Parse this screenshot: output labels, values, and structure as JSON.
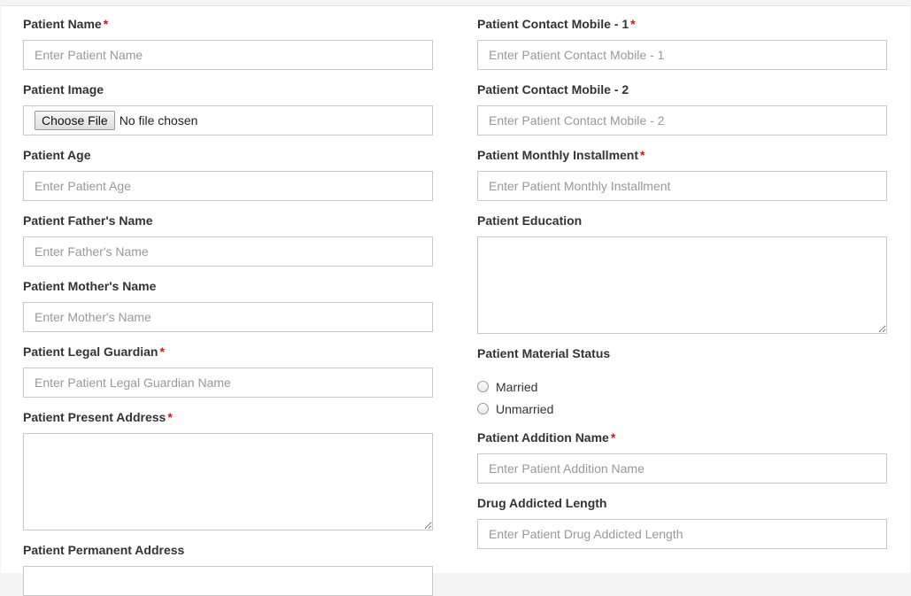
{
  "left_column": [
    {
      "id": "patient-name",
      "label": "Patient Name",
      "required": "*",
      "type": "text",
      "placeholder": "Enter Patient Name"
    },
    {
      "id": "patient-image",
      "label": "Patient Image",
      "required": "",
      "type": "file",
      "button": "Choose File",
      "status": "No file chosen"
    },
    {
      "id": "patient-age",
      "label": "Patient Age",
      "required": "",
      "type": "text",
      "placeholder": "Enter Patient Age"
    },
    {
      "id": "father-name",
      "label": "Patient Father's Name",
      "required": "",
      "type": "text",
      "placeholder": "Enter Father's Name"
    },
    {
      "id": "mother-name",
      "label": "Patient Mother's Name",
      "required": "",
      "type": "text",
      "placeholder": "Enter Mother's Name"
    },
    {
      "id": "legal-guardian",
      "label": "Patient Legal Guardian",
      "required": "*",
      "type": "text",
      "placeholder": "Enter Patient Legal Guardian Name"
    },
    {
      "id": "present-address",
      "label": "Patient Present Address",
      "required": "*",
      "type": "textarea",
      "placeholder": ""
    },
    {
      "id": "permanent-address",
      "label": "Patient Permanent Address",
      "required": "",
      "type": "text",
      "placeholder": ""
    }
  ],
  "right_column": [
    {
      "id": "contact-mobile-1",
      "label": "Patient Contact Mobile - 1",
      "required": "*",
      "type": "text",
      "placeholder": "Enter Patient Contact Mobile - 1"
    },
    {
      "id": "contact-mobile-2",
      "label": "Patient Contact Mobile - 2",
      "required": "",
      "type": "text",
      "placeholder": "Enter Patient Contact Mobile - 2"
    },
    {
      "id": "monthly-installment",
      "label": "Patient Monthly Installment",
      "required": "*",
      "type": "text",
      "placeholder": "Enter Patient Monthly Installment"
    },
    {
      "id": "education",
      "label": "Patient Education",
      "required": "",
      "type": "textarea",
      "placeholder": ""
    },
    {
      "id": "material-status",
      "label": "Patient Material Status",
      "required": "",
      "type": "radio",
      "options": [
        "Married",
        "Unmarried"
      ]
    },
    {
      "id": "addition-name",
      "label": "Patient Addition Name",
      "required": "*",
      "type": "text",
      "placeholder": "Enter Patient Addition Name"
    },
    {
      "id": "drug-addicted-length",
      "label": "Drug Addicted Length",
      "required": "",
      "type": "text",
      "placeholder": "Enter Patient Drug Addicted Length"
    }
  ],
  "colors": {
    "required": "#dd1111",
    "label": "#333333",
    "placeholder": "#999999",
    "border": "#c8c8c8"
  }
}
